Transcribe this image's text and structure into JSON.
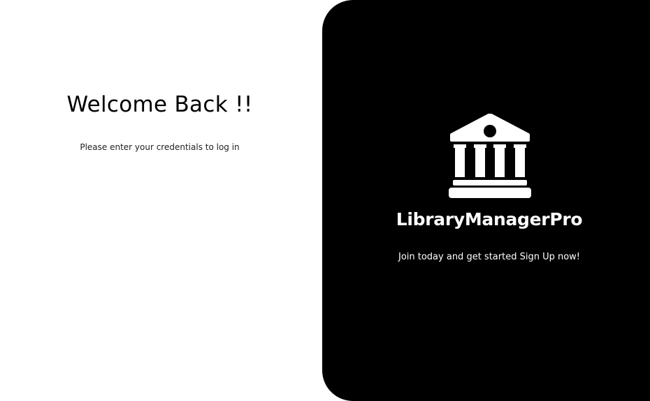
{
  "login": {
    "title": "Welcome Back !!",
    "subtitle": "Please enter your credentials to log in"
  },
  "brand": {
    "logo_icon": "bank-building-icon",
    "name": "LibraryManagerPro",
    "tagline": "Join today and get started Sign Up now!"
  },
  "colors": {
    "background": "#ffffff",
    "panel": "#000000",
    "text_dark": "#000000",
    "text_light": "#ffffff"
  }
}
